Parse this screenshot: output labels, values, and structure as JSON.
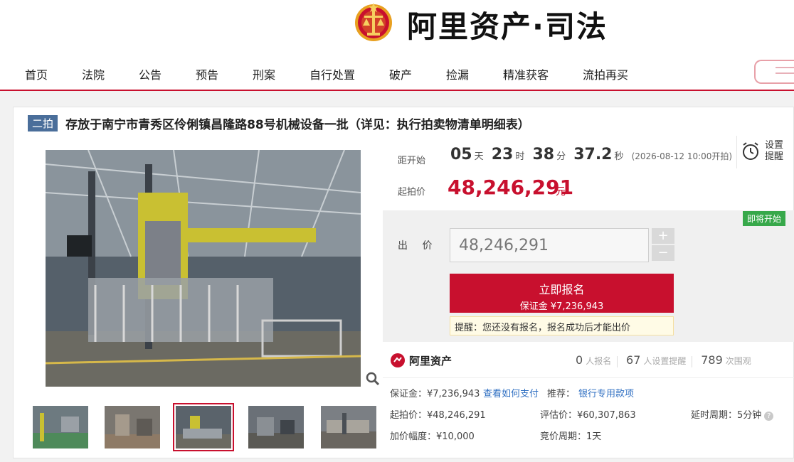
{
  "site": {
    "title": "阿里资产·司法"
  },
  "nav": {
    "items": [
      "首页",
      "法院",
      "公告",
      "预告",
      "刑案",
      "自行处置",
      "破产",
      "捡漏",
      "精准获客",
      "流拍再买"
    ]
  },
  "item": {
    "round_tag": "二拍",
    "title": "存放于南宁市青秀区伶俐镇昌隆路88号机械设备一批（详见：执行拍卖物清单明细表）"
  },
  "countdown": {
    "label": "距开始",
    "days": "05",
    "days_unit": "天",
    "hours": "23",
    "hours_unit": "时",
    "minutes": "38",
    "minutes_unit": "分",
    "seconds": "37.2",
    "seconds_unit": "秒",
    "start_time": "(2026-08-12 10:00开拍)"
  },
  "reminder": {
    "label": "设置提醒"
  },
  "price": {
    "start_label": "起拍价",
    "start_value": "48,246,291",
    "unit": "元"
  },
  "bid": {
    "status_badge": "即将开始",
    "label": "出 价",
    "input_value": "48,246,291",
    "plus": "+",
    "minus": "−",
    "register_label": "立即报名",
    "register_deposit": "保证金 ¥7,236,943",
    "tip": "提醒：您还没有报名，报名成功后才能出价"
  },
  "seller": {
    "name": "阿里资产",
    "signup_count": "0",
    "signup_label": "人报名",
    "reminder_count": "67",
    "reminder_label": "人设置提醒",
    "view_count": "789",
    "view_label": "次围观"
  },
  "details": {
    "deposit": "保证金：¥7,236,943",
    "how_to_pay": "查看如何支付",
    "recommend_label": "推荐：",
    "recommend_link": "银行专用款项",
    "start_price": "起拍价：¥48,246,291",
    "eval_price": "评估价：¥60,307,863",
    "delay_period": "延时周期：5分钟",
    "increment": "加价幅度：¥10,000",
    "bid_period": "竞价周期：1天"
  },
  "colors": {
    "brand_red": "#c8102e",
    "tag_blue": "#4a6e9a",
    "link_blue": "#2f6fc2",
    "badge_green": "#37a84a"
  }
}
